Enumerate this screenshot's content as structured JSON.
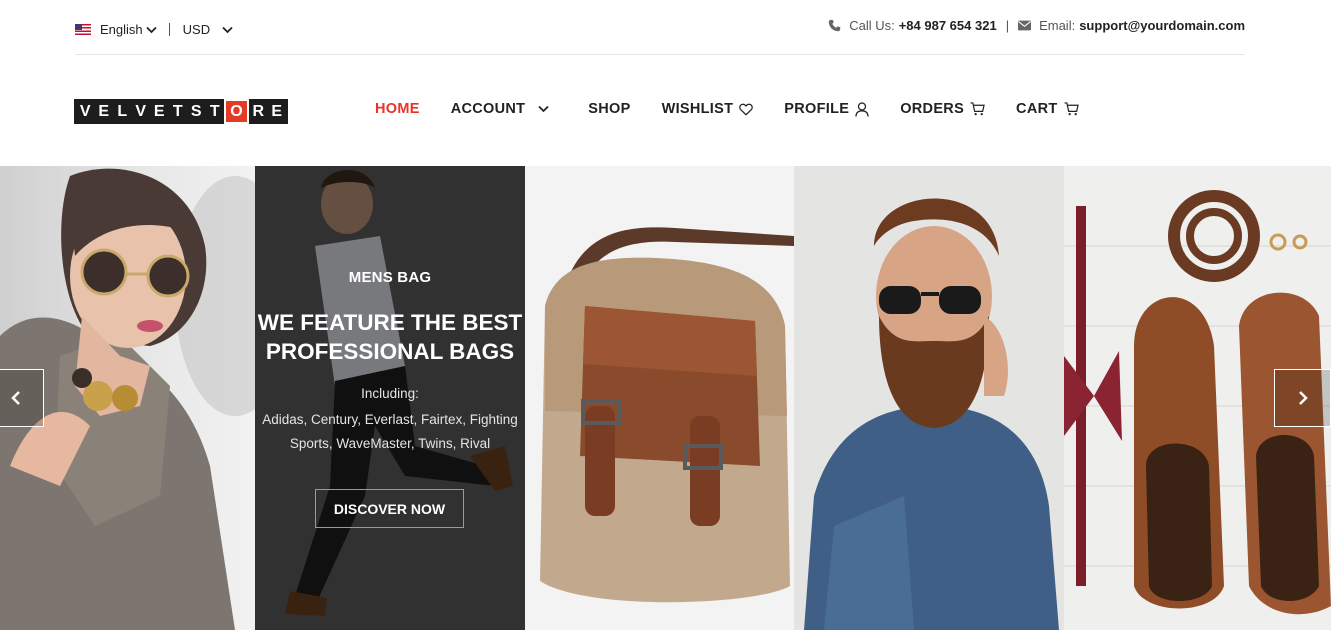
{
  "topbar": {
    "language": "English",
    "currency": "USD",
    "call_label": "Call Us:",
    "phone": "+84 987 654 321",
    "separator": "|",
    "email_label": "Email:",
    "email": "support@yourdomain.com"
  },
  "logo": {
    "letters": [
      "V",
      "E",
      "L",
      "V",
      "E",
      "T",
      "S",
      "T",
      "O",
      "R",
      "E"
    ],
    "accent_index": 8,
    "accent_color": "#e43b27"
  },
  "nav": {
    "home": "HOME",
    "account": "ACCOUNT",
    "shop": "SHOP",
    "wishlist": "WISHLIST",
    "profile": "PROFILE",
    "orders": "ORDERS",
    "cart": "CART",
    "active_color": "#e8332a"
  },
  "hero": {
    "kicker": "MENS BAG",
    "headline_line1": "WE FEATURE THE BEST",
    "headline_line2": "PROFESSIONAL BAGS",
    "including": "Including:",
    "brands": "Adidas, Century, Everlast, Fairtex, Fighting Sports, WaveMaster, Twins, Rival",
    "cta": "DISCOVER NOW",
    "panels": [
      "woman-sunglasses-photo",
      "running-man-photo",
      "leather-bag-photo",
      "bearded-man-photo",
      "shoes-belt-photo"
    ]
  }
}
